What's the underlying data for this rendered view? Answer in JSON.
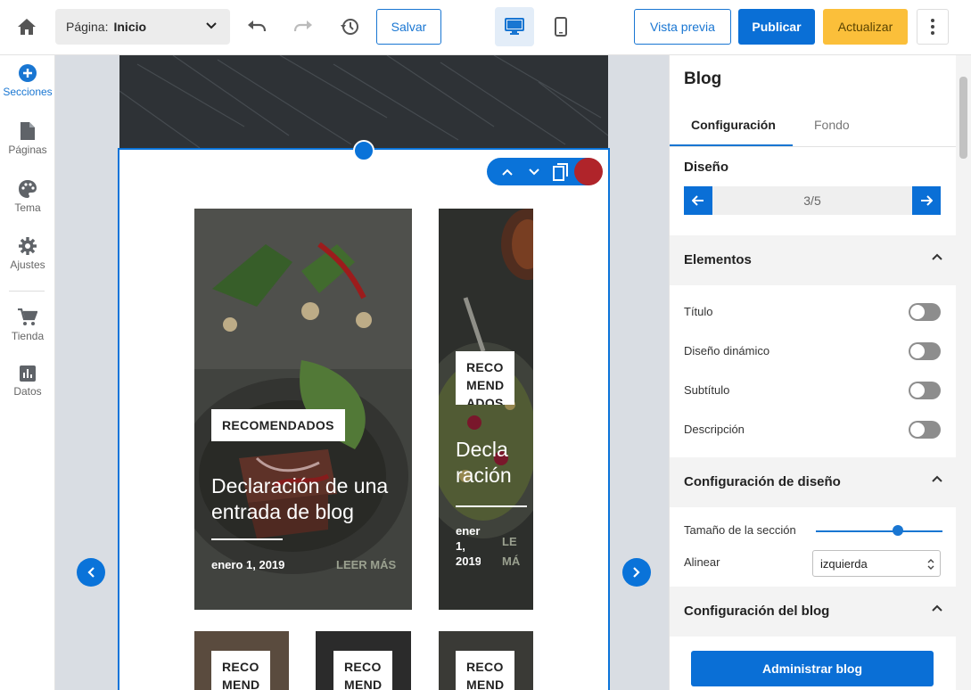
{
  "topbar": {
    "page_label": "Página:",
    "page_value": "Inicio",
    "save": "Salvar",
    "preview": "Vista previa",
    "publish": "Publicar",
    "update": "Actualizar"
  },
  "nav": {
    "items": [
      {
        "label": "Secciones",
        "icon": "add-circle-icon"
      },
      {
        "label": "Páginas",
        "icon": "page-icon"
      },
      {
        "label": "Tema",
        "icon": "palette-icon"
      },
      {
        "label": "Ajustes",
        "icon": "gear-icon"
      },
      {
        "label": "Tienda",
        "icon": "cart-icon"
      },
      {
        "label": "Datos",
        "icon": "chart-icon"
      }
    ]
  },
  "canvas": {
    "cards": [
      {
        "badge": "RECOMENDADOS",
        "title": "Declaración de una entrada de blog",
        "date": "enero 1, 2019",
        "more": "LEER MÁS"
      },
      {
        "badge": "RECO\nMEND\nADOS",
        "title": "Decla\nración",
        "date": "ener\n1,\n2019",
        "more": "LE\nMÁ"
      },
      {
        "badge": "RECO\nMEND"
      },
      {
        "badge": "RECO\nMEND"
      },
      {
        "badge": "RECO\nMEND"
      }
    ]
  },
  "panel": {
    "title": "Blog",
    "tabs": [
      "Configuración",
      "Fondo"
    ],
    "design_label": "Diseño",
    "design_value": "3/5",
    "elements_header": "Elementos",
    "elements": [
      "Título",
      "Diseño dinámico",
      "Subtítulo",
      "Descripción"
    ],
    "layout_header": "Configuración de diseño",
    "section_size_label": "Tamaño de la sección",
    "section_size_value": 0.65,
    "align_label": "Alinear",
    "align_value": "izquierda",
    "blog_header": "Configuración del blog",
    "manage_button": "Administrar blog"
  },
  "colors": {
    "accent": "#0a6fd6",
    "update_button": "#fbbf3a",
    "delete_dot": "#b0242a"
  }
}
